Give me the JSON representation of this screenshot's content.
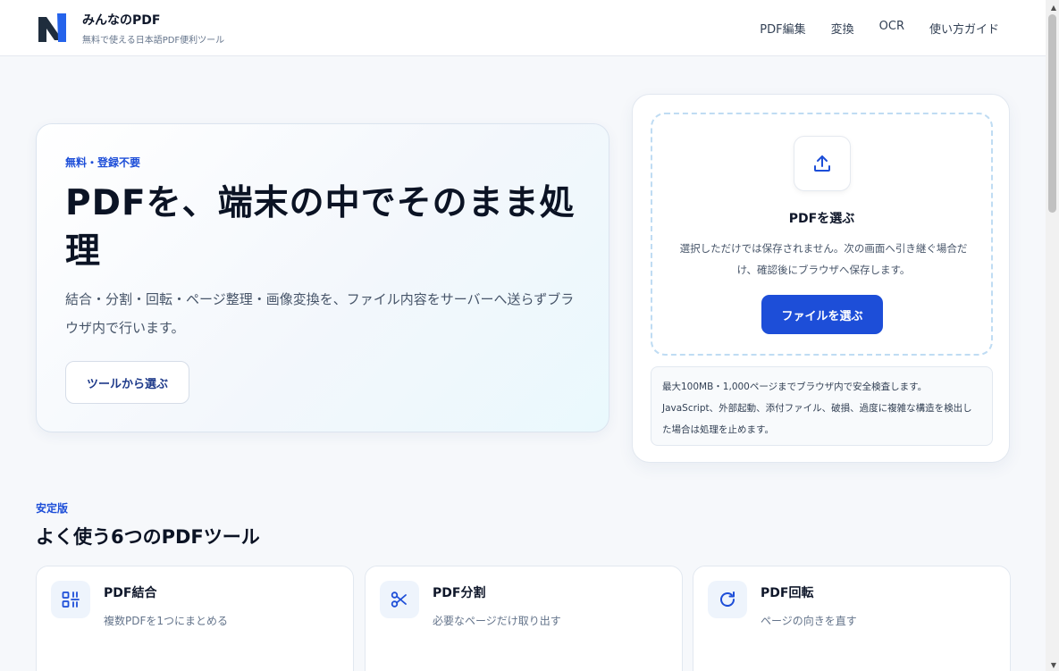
{
  "header": {
    "brand_name": "みんなのPDF",
    "brand_tagline": "無料で使える日本語PDF便利ツール",
    "nav": [
      "PDF編集",
      "変換",
      "OCR",
      "使い方ガイド"
    ]
  },
  "hero": {
    "eyebrow": "無料・登録不要",
    "title": "PDFを、端末の中でそのまま処理",
    "description": "結合・分割・回転・ページ整理・画像変換を、ファイル内容をサーバーへ送らずブラウザ内で行います。",
    "cta_label": "ツールから選ぶ"
  },
  "upload": {
    "icon": "upload-icon",
    "title": "PDFを選ぶ",
    "description": "選択しただけでは保存されません。次の画面へ引き継ぐ場合だけ、確認後にブラウザへ保存します。",
    "button_label": "ファイルを選ぶ",
    "note_line1": "最大100MB・1,000ページまでブラウザ内で安全検査します。",
    "note_line2": "JavaScript、外部起動、添付ファイル、破損、過度に複雑な構造を検出した場合は処理を止めます。"
  },
  "tools": {
    "eyebrow": "安定版",
    "title": "よく使う6つのPDFツール",
    "items": [
      {
        "name": "PDF結合",
        "desc": "複数PDFを1つにまとめる",
        "icon": "merge-icon"
      },
      {
        "name": "PDF分割",
        "desc": "必要なページだけ取り出す",
        "icon": "scissors-icon"
      },
      {
        "name": "PDF回転",
        "desc": "ページの向きを直す",
        "icon": "rotate-icon"
      }
    ]
  },
  "colors": {
    "accent": "#1d4ed8",
    "text": "#0f172a",
    "muted": "#64748b",
    "background": "#f6f8fb"
  }
}
